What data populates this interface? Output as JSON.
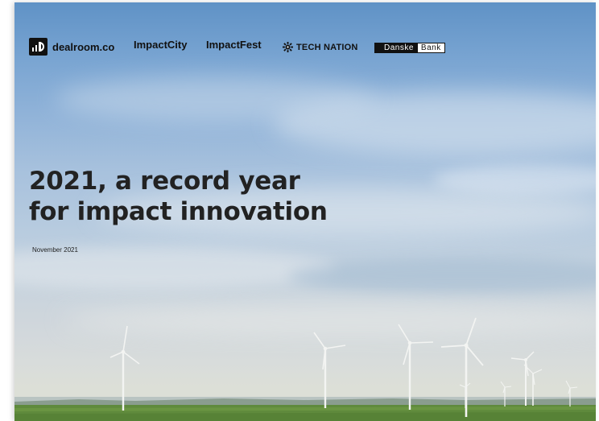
{
  "logos": {
    "dealroom": "dealroom.co",
    "impactcity": "ImpactCity",
    "impactfest": "ImpactFest",
    "technation": "TECH NATION",
    "danske_left": "Danske",
    "danske_right": "Bank"
  },
  "icons": {
    "dealroom": "dealroom-logo-icon",
    "technation": "gear-icon",
    "turbines": "wind-turbine-icon"
  },
  "cover": {
    "title_line1": "2021, a record year",
    "title_line2": "for impact innovation",
    "date": "November 2021"
  },
  "colors": {
    "sky_top": "#5f92c6",
    "sky_bottom": "#dcdfd7",
    "field": "#5f8a3c",
    "title_text": "#222222"
  }
}
